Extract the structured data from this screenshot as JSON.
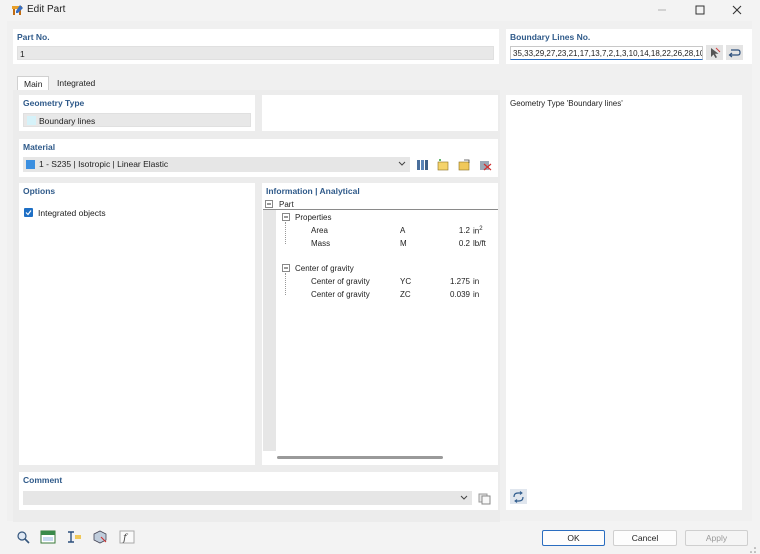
{
  "window": {
    "title": "Edit Part"
  },
  "part_no": {
    "label": "Part No.",
    "value": "1"
  },
  "boundary": {
    "label": "Boundary Lines No.",
    "value": "35,33,29,27,23,21,17,13,7,2,1,3,10,14,18,22,26,28,10"
  },
  "tabs": [
    {
      "label": "Main"
    },
    {
      "label": "Integrated"
    }
  ],
  "geometry": {
    "label": "Geometry Type",
    "value": "Boundary lines",
    "swatch_color": "#d6f2f9"
  },
  "material": {
    "label": "Material",
    "value": "1 - S235 | Isotropic | Linear Elastic",
    "swatch_color": "#3b8fe0"
  },
  "options": {
    "label": "Options",
    "integrated_objects": {
      "label": "Integrated objects",
      "checked": true
    }
  },
  "info": {
    "label": "Information | Analytical",
    "part": "Part",
    "properties": "Properties",
    "rows": [
      {
        "name": "Area",
        "symbol": "A",
        "value": "1.2",
        "unit": "in",
        "sup": "2"
      },
      {
        "name": "Mass",
        "symbol": "M",
        "value": "0.2",
        "unit": "lb/ft",
        "sup": ""
      }
    ],
    "cog_group": "Center of gravity",
    "cog_rows": [
      {
        "name": "Center of gravity",
        "symbol": "YC",
        "value": "1.275",
        "unit": "in"
      },
      {
        "name": "Center of gravity",
        "symbol": "ZC",
        "value": "0.039",
        "unit": "in"
      }
    ]
  },
  "comment": {
    "label": "Comment",
    "value": ""
  },
  "description": "Geometry Type 'Boundary lines'",
  "buttons": {
    "ok": "OK",
    "cancel": "Cancel",
    "apply": "Apply"
  },
  "colors": {
    "accent": "#2f5a8a",
    "check": "#1e6fc5"
  }
}
